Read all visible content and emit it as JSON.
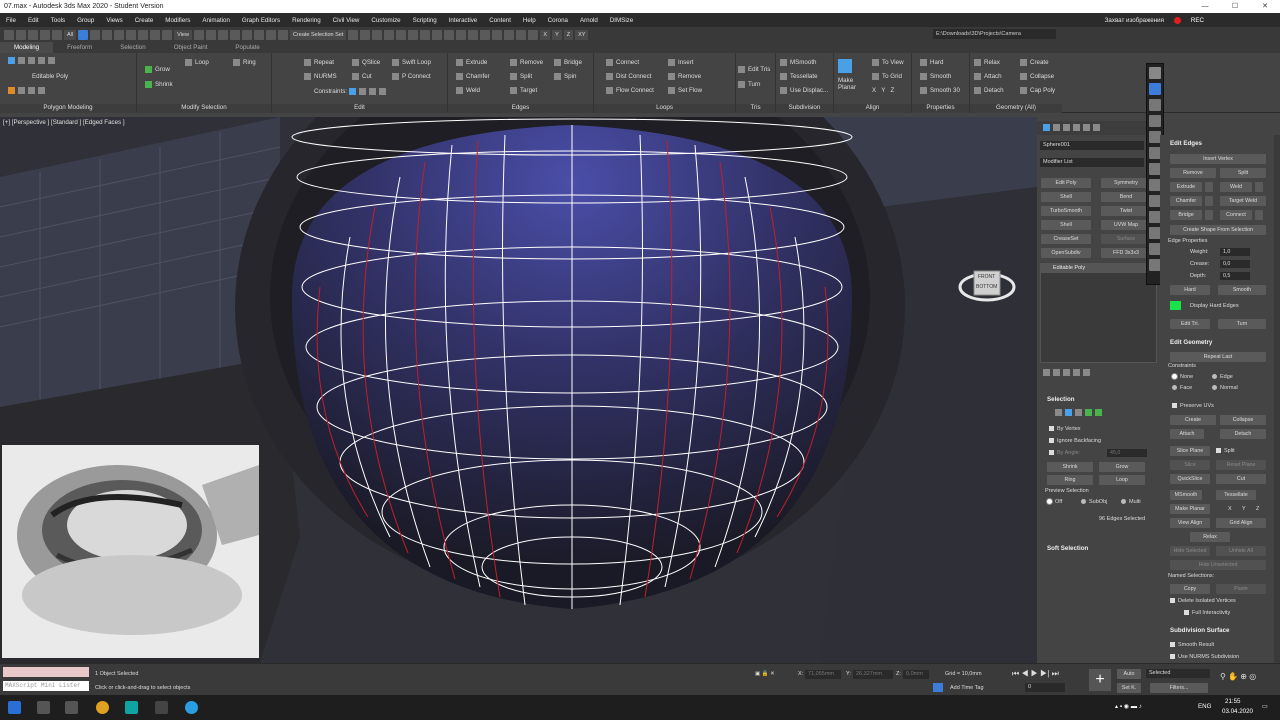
{
  "window": {
    "title": "07.max - Autodesk 3ds Max 2020 - Student Version",
    "controls": [
      "—",
      "☐",
      "✕"
    ]
  },
  "menubar": {
    "items": [
      "File",
      "Edit",
      "Tools",
      "Group",
      "Views",
      "Create",
      "Modifiers",
      "Animation",
      "Graph Editors",
      "Rendering",
      "Civil View",
      "Customize",
      "Scripting",
      "Interactive",
      "Content",
      "Help",
      "Corona",
      "Arnold",
      "DIMSize"
    ],
    "capture_label": "Захват изображения",
    "rec_label": "REC"
  },
  "toolbar": {
    "filter": "All",
    "ref_coord": "View",
    "selection_set": "Create Selection Set",
    "axes": [
      "X",
      "Y",
      "Z",
      "XY"
    ],
    "path": "E:\\Downloads\\3D\\Projects\\Camera"
  },
  "ribbon_tabs": {
    "items": [
      "Modeling",
      "Freeform",
      "Selection",
      "Object Paint",
      "Populate"
    ],
    "active": "Modeling"
  },
  "ribbon": {
    "poly_modeling": {
      "label": "Editable Poly",
      "title": "Polygon Modeling"
    },
    "modify_selection": {
      "grow": "Grow",
      "shrink": "Shrink",
      "loop": "Loop",
      "ring": "Ring",
      "title": "Modify Selection"
    },
    "edit": {
      "repeat": "Repeat",
      "qslice": "QSlice",
      "swift_loop": "Swift Loop",
      "nurms": "NURMS",
      "cut": "Cut",
      "p_connect": "P Connect",
      "constraints": "Constraints:",
      "title": "Edit"
    },
    "edges": {
      "extrude": "Extrude",
      "remove": "Remove",
      "bridge": "Bridge",
      "chamfer": "Chamfer",
      "split": "Split",
      "spin": "Spin",
      "weld": "Weld",
      "target": "Target",
      "title": "Edges"
    },
    "loops": {
      "connect": "Connect",
      "insert": "Insert",
      "dist_connect": "Dist Connect",
      "remove": "Remove",
      "flow_connect": "Flow Connect",
      "set_flow": "Set Flow",
      "title": "Loops"
    },
    "tris": {
      "edit_tris": "Edit Tris",
      "turn": "Turn",
      "title": "Tris"
    },
    "subdivision": {
      "msmooth": "MSmooth",
      "tessellate": "Tessellate",
      "use_displac": "Use Displac...",
      "title": "Subdivision"
    },
    "align": {
      "make_planar": "Make Planar",
      "to_view": "To View",
      "to_grid": "To Grid",
      "xyz": [
        "X",
        "Y",
        "Z"
      ],
      "title": "Align"
    },
    "properties": {
      "hard": "Hard",
      "smooth": "Smooth",
      "smooth30": "Smooth 30",
      "title": "Properties"
    },
    "geometry": {
      "relax": "Relax",
      "create": "Create",
      "attach": "Attach",
      "collapse": "Collapse",
      "detach": "Detach",
      "cap_poly": "Cap Poly",
      "title": "Geometry (All)"
    }
  },
  "viewport": {
    "label": "[+] [Perspective ] [Standard ] [Edged Faces ]",
    "viewcube": [
      "FRONT",
      "BOTTOM"
    ]
  },
  "modifier_panel": {
    "object_name": "Sphere001",
    "modifier_list": "Modifier List",
    "buttons": [
      "Edit Poly",
      "Symmetry",
      "Shell",
      "Bend",
      "TurboSmooth",
      "Twist",
      "Shell",
      "UVW Map",
      "CreaseSet",
      "Surface",
      "OpenSubdiv",
      "FFD 3x3x3"
    ],
    "stack_item": "Editable Poly",
    "selection": {
      "title": "Selection",
      "by_vertex": "By Vertex",
      "ignore_backfacing": "Ignore Backfacing",
      "by_angle": "By Angle:",
      "angle_value": "45,0",
      "shrink": "Shrink",
      "grow": "Grow",
      "ring": "Ring",
      "loop": "Loop",
      "preview_selection": "Preview Selection",
      "preview_options": [
        "Off",
        "SubObj",
        "Multi"
      ],
      "status": "96 Edges Selected"
    },
    "soft_selection": "Soft Selection"
  },
  "command_panel": {
    "edit_edges": {
      "title": "Edit Edges",
      "insert_vertex": "Insert Vertex",
      "remove": "Remove",
      "split": "Split",
      "extrude": "Extrude",
      "weld": "Weld",
      "chamfer": "Chamfer",
      "target_weld": "Target Weld",
      "bridge": "Bridge",
      "connect": "Connect",
      "create_shape": "Create Shape From Selection",
      "edge_properties": "Edge Properties",
      "weight_label": "Weight:",
      "weight": "1,0",
      "crease_label": "Crease:",
      "crease": "0,0",
      "depth_label": "Depth:",
      "depth": "0,5",
      "hard": "Hard",
      "smooth": "Smooth",
      "display_hard_edges": "Display Hard Edges",
      "edit_tri": "Edit Tri.",
      "turn": "Turn"
    },
    "edit_geometry": {
      "title": "Edit Geometry",
      "repeat_last": "Repeat Last",
      "constraints": "Constraints",
      "none": "None",
      "edge": "Edge",
      "face": "Face",
      "normal": "Normal",
      "preserve_uvs": "Preserve UVs",
      "create": "Create",
      "collapse": "Collapse",
      "attach": "Attach",
      "detach": "Detach",
      "slice_plane": "Slice Plane",
      "split": "Split",
      "slice": "Slice",
      "reset_plane": "Reset Plane",
      "quickslice": "QuickSlice",
      "cut": "Cut",
      "msmooth": "MSmooth",
      "tessellate": "Tessellate",
      "make_planar": "Make Planar",
      "x": "X",
      "y": "Y",
      "z": "Z",
      "view_align": "View Align",
      "grid_align": "Grid Align",
      "relax": "Relax",
      "hide_selected": "Hide Selected",
      "unhide_all": "Unhide All",
      "hide_unselected": "Hide Unselected",
      "named_selections": "Named Selections:",
      "copy": "Copy",
      "paste": "Paste",
      "delete_isolated": "Delete Isolated Vertices",
      "full_interactivity": "Full Interactivity"
    },
    "subdivision_surface": {
      "title": "Subdivision Surface",
      "smooth_result": "Smooth Result",
      "use_nurms": "Use NURMS Subdivision"
    }
  },
  "statusbar": {
    "maxscript": "MAXScript Mini Lister",
    "objects": "1 Object Selected",
    "prompt": "Click or click-and-drag to select objects",
    "x_label": "X:",
    "x_value": "71,055mm",
    "y_label": "Y:",
    "y_value": "26,327mm",
    "z_label": "Z:",
    "z_value": "0,0mm",
    "grid": "Grid = 10,0mm",
    "add_time_tag": "Add Time Tag",
    "frame": "0",
    "auto": "Auto",
    "setk": "Set K.",
    "selected": "Selected",
    "filters": "Filters..."
  },
  "taskbar": {
    "lang": "ENG",
    "time": "21:55",
    "date": "03.04.2020"
  },
  "colors": {
    "accent": "#3b7dd8",
    "selected_edge": "#c0202a",
    "wire": "#ffffff",
    "hard_edge_swatch": "#19e34a"
  }
}
